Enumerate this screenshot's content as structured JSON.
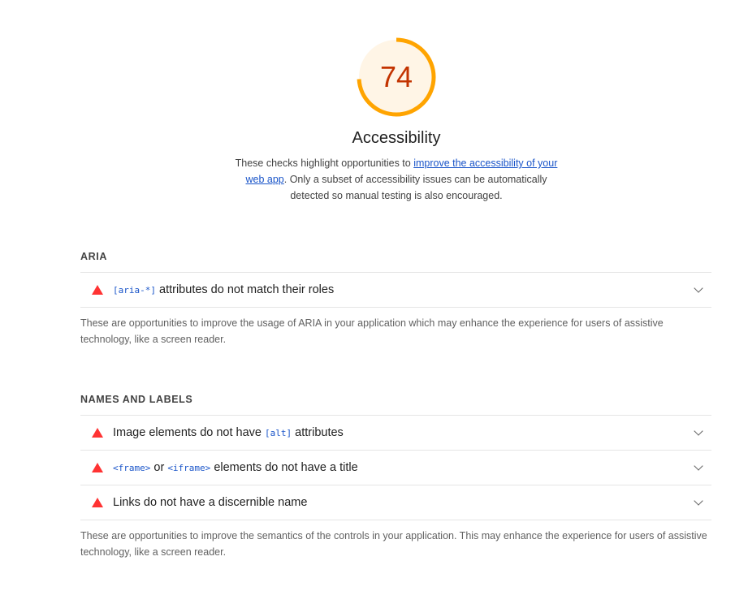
{
  "gauge": {
    "score": "74",
    "fraction": 0.74,
    "color": "#ffa400",
    "fill": "#fff5e6",
    "text_color": "#c33300"
  },
  "category": {
    "title": "Accessibility",
    "description_before": "These checks highlight opportunities to ",
    "description_link": "improve the accessibility of your web app",
    "description_after": ". Only a subset of accessibility issues can be automatically detected so manual testing is also encouraged."
  },
  "groups": [
    {
      "title": "ARIA",
      "audits": [
        {
          "code": "[aria-*]",
          "text": " attributes do not match their roles"
        }
      ],
      "description": "These are opportunities to improve the usage of ARIA in your application which may enhance the experience for users of assistive technology, like a screen reader."
    },
    {
      "title": "NAMES AND LABELS",
      "audits": [
        {
          "text_before": "Image elements do not have ",
          "code": "[alt]",
          "text_after": " attributes"
        },
        {
          "code1": "<frame>",
          "mid": " or ",
          "code2": "<iframe>",
          "text_after": " elements do not have a title"
        },
        {
          "text": "Links do not have a discernible name"
        }
      ],
      "description": "These are opportunities to improve the semantics of the controls in your application. This may enhance the experience for users of assistive technology, like a screen reader."
    }
  ],
  "colors": {
    "fail": "#ff3333",
    "link": "#1a55c9"
  }
}
